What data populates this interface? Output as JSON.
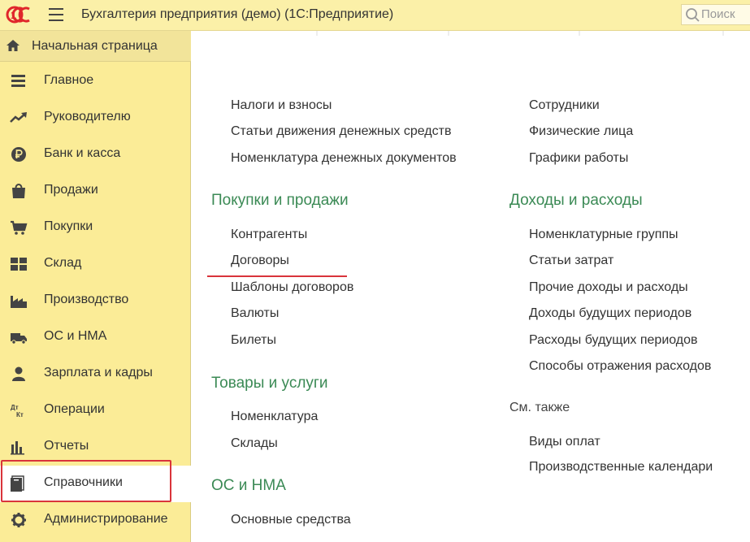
{
  "app": {
    "title": "Бухгалтерия предприятия (демо)  (1С:Предприятие)",
    "search_placeholder": "Поиск",
    "logo_text": "1С"
  },
  "sidebar": {
    "home_label": "Начальная страница",
    "items": [
      {
        "label": "Главное",
        "icon": "menu-lines-icon"
      },
      {
        "label": "Руководителю",
        "icon": "trend-icon"
      },
      {
        "label": "Банк и касса",
        "icon": "ruble-coin-icon"
      },
      {
        "label": "Продажи",
        "icon": "shopping-bag-icon"
      },
      {
        "label": "Покупки",
        "icon": "cart-icon"
      },
      {
        "label": "Склад",
        "icon": "warehouse-grid-icon"
      },
      {
        "label": "Производство",
        "icon": "factory-icon"
      },
      {
        "label": "ОС и НМА",
        "icon": "truck-icon"
      },
      {
        "label": "Зарплата и кадры",
        "icon": "person-icon"
      },
      {
        "label": "Операции",
        "icon": "debit-credit-icon"
      },
      {
        "label": "Отчеты",
        "icon": "bar-chart-icon"
      },
      {
        "label": "Справочники",
        "icon": "books-icon",
        "active": true
      },
      {
        "label": "Администрирование",
        "icon": "gear-icon"
      }
    ],
    "debit_credit_text": {
      "top": "Дт",
      "bottom": "Кт"
    }
  },
  "content": {
    "left_column": {
      "top_links": [
        "Налоги и взносы",
        "Статьи движения денежных средств",
        "Номенклатура денежных документов"
      ],
      "sections": [
        {
          "title": "Покупки и продажи",
          "links": [
            "Контрагенты",
            "Договоры",
            "Шаблоны договоров",
            "Валюты",
            "Билеты"
          ]
        },
        {
          "title": "Товары и услуги",
          "links": [
            "Номенклатура",
            "Склады"
          ]
        },
        {
          "title": "ОС и НМА",
          "links": [
            "Основные средства"
          ]
        }
      ]
    },
    "right_column": {
      "top_links": [
        "Сотрудники",
        "Физические лица",
        "Графики работы"
      ],
      "sections": [
        {
          "title": "Доходы и расходы",
          "links": [
            "Номенклатурные группы",
            "Статьи затрат",
            "Прочие доходы и расходы",
            "Доходы будущих периодов",
            "Расходы будущих периодов",
            "Способы отражения расходов"
          ]
        }
      ],
      "see_also": {
        "title": "См. также",
        "links": [
          "Виды оплат",
          "Производственные календари"
        ]
      }
    }
  },
  "colors": {
    "sidebar_bg": "#fbec97",
    "titlebar_bg": "#fbf0a8",
    "section_title": "#3b8a55",
    "highlight_red": "#d9343b",
    "logo_red": "#e0262b"
  }
}
